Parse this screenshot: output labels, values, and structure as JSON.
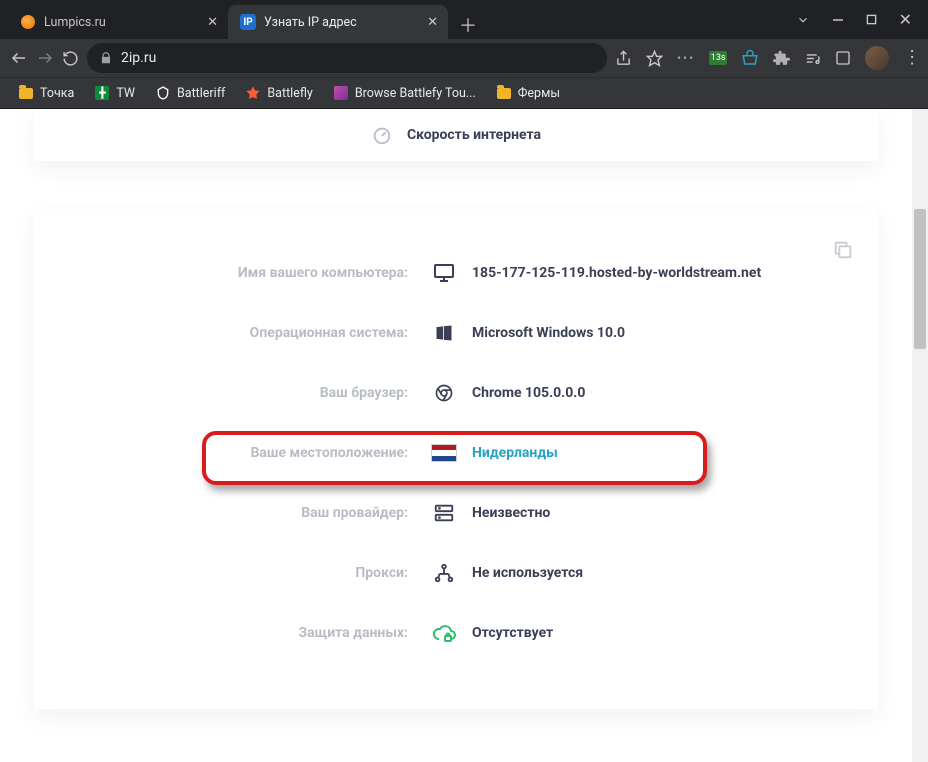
{
  "window": {
    "tabs": [
      {
        "title": "Lumpics.ru",
        "active": false,
        "favicon": "lumpics"
      },
      {
        "title": "Узнать IP адрес",
        "active": true,
        "favicon": "2ip",
        "favicon_text": "IP"
      }
    ],
    "controls": {
      "min": "min",
      "max": "max",
      "close": "×"
    }
  },
  "toolbar": {
    "url": "2ip.ru",
    "ext_badge_text": "13s"
  },
  "bookmarks": [
    {
      "icon": "folder",
      "label": "Точка"
    },
    {
      "icon": "tw",
      "label": "TW"
    },
    {
      "icon": "battleriff",
      "label": "Battleriff"
    },
    {
      "icon": "battlefly",
      "label": "Battlefly"
    },
    {
      "icon": "browse",
      "label": "Browse Battlefy Tou..."
    },
    {
      "icon": "folder",
      "label": "Фермы"
    }
  ],
  "page": {
    "speed_label": "Скорость интернета",
    "rows": {
      "hostname": {
        "label": "Имя вашего компьютера:",
        "value": "185-177-125-119.hosted-by-worldstream.net"
      },
      "os": {
        "label": "Операционная система:",
        "value": "Microsoft Windows 10.0"
      },
      "browser": {
        "label": "Ваш браузер:",
        "value": "Chrome 105.0.0.0"
      },
      "location": {
        "label": "Ваше местоположение:",
        "value": "Нидерланды",
        "flag": "nl"
      },
      "provider": {
        "label": "Ваш провайдер:",
        "value": "Неизвестно"
      },
      "proxy": {
        "label": "Прокси:",
        "value": "Не используется"
      },
      "protection": {
        "label": "Защита данных:",
        "value": "Отсутствует"
      }
    }
  }
}
